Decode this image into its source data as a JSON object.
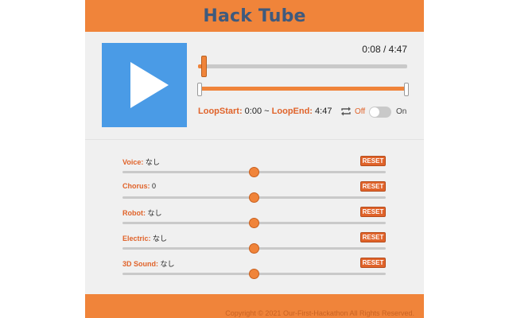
{
  "app": {
    "title": "Hack Tube"
  },
  "player": {
    "time": "0:08 / 4:47",
    "progress": 0.028,
    "loop_start_label": "LoopStart:",
    "loop_start_value": "0:00",
    "loop_separator": "~",
    "loop_end_label": "LoopEnd:",
    "loop_end_value": "4:47",
    "toggle_off_label": "Off",
    "toggle_on_label": "On",
    "loop_enabled": false
  },
  "effects": [
    {
      "label": "Voice:",
      "value": "なし",
      "reset_label": "RESET",
      "level": 0.5
    },
    {
      "label": "Chorus:",
      "value": "0",
      "reset_label": "RESET",
      "level": 0.5
    },
    {
      "label": "Robot:",
      "value": "なし",
      "reset_label": "RESET",
      "level": 0.5
    },
    {
      "label": "Electric:",
      "value": "なし",
      "reset_label": "RESET",
      "level": 0.5
    },
    {
      "label": "3D Sound:",
      "value": "なし",
      "reset_label": "RESET",
      "level": 0.5
    }
  ],
  "footer": {
    "copyright": "Copyright © 2021 Our-First-Hackathon All Rights Reserved."
  },
  "colors": {
    "accent": "#f0843a",
    "title": "#3f5a7d",
    "play": "#4a9be6",
    "label": "#e0632a"
  }
}
